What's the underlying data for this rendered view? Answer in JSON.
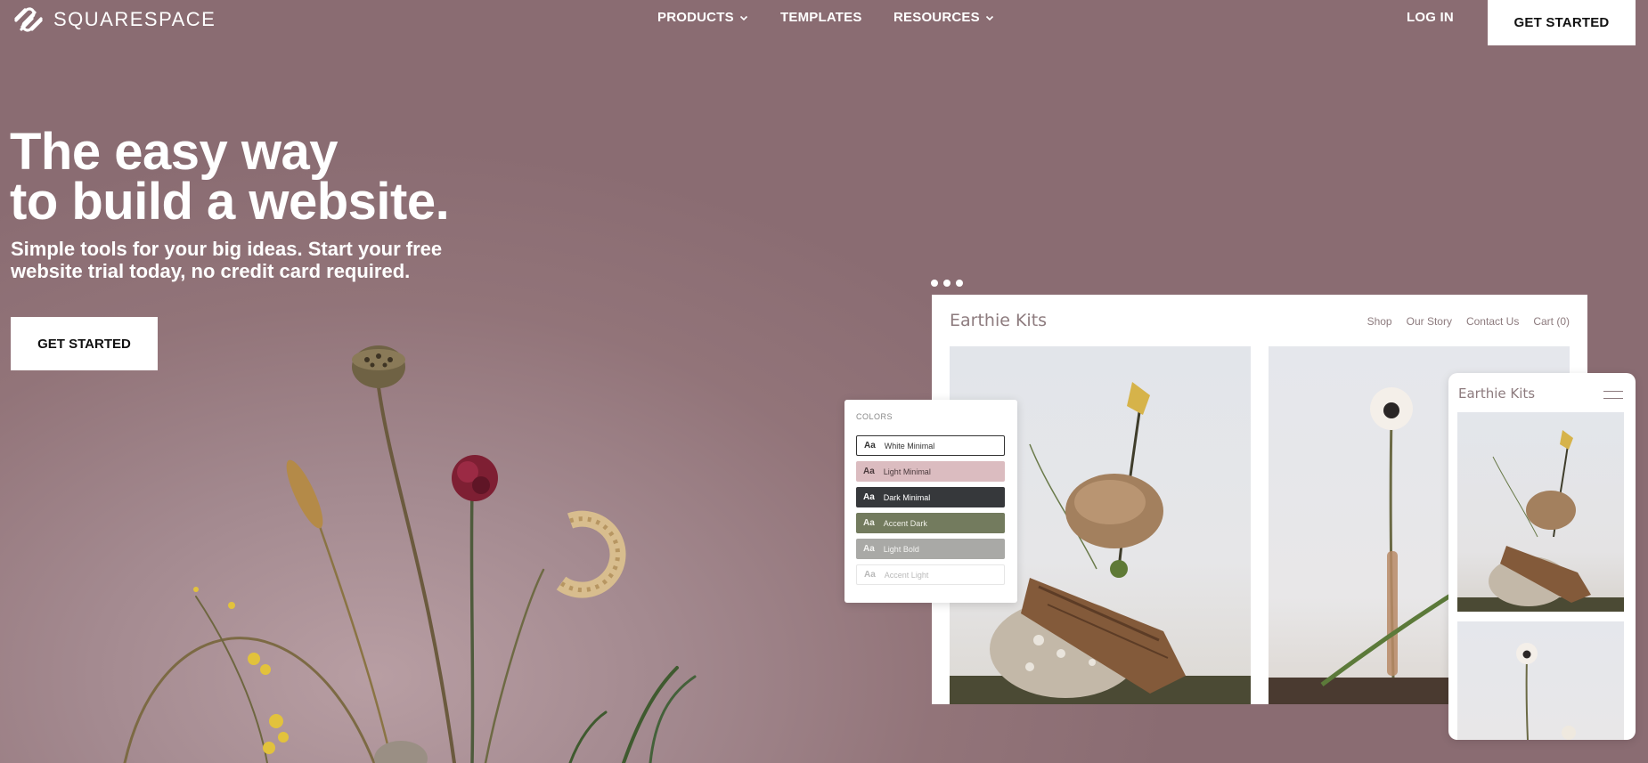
{
  "nav": {
    "logo_text": "SQUARESPACE",
    "logo_icon": "squarespace-logo-icon",
    "items": [
      {
        "label": "PRODUCTS",
        "has_dropdown": true
      },
      {
        "label": "TEMPLATES",
        "has_dropdown": false
      },
      {
        "label": "RESOURCES",
        "has_dropdown": true
      }
    ],
    "login_label": "LOG IN",
    "cta_label": "GET STARTED"
  },
  "hero": {
    "title_line1": "The easy way",
    "title_line2": "to build a website.",
    "subtitle_line1": "Simple tools for your big ideas. Start your free",
    "subtitle_line2": "website trial today, no credit card required.",
    "cta_label": "GET STARTED"
  },
  "desktop_mockup": {
    "brand": "Earthie Kits",
    "nav": [
      "Shop",
      "Our Story",
      "Contact Us",
      "Cart (0)"
    ]
  },
  "colors_panel": {
    "title": "COLORS",
    "swatch_glyph": "Aa",
    "swatches": [
      {
        "label": "White Minimal",
        "bg": "#ffffff",
        "fg": "#333333",
        "border": "#333333"
      },
      {
        "label": "Light Minimal",
        "bg": "#dbbcc0",
        "fg": "#4a3a3c",
        "border": "#dbbcc0"
      },
      {
        "label": "Dark Minimal",
        "bg": "#36383b",
        "fg": "#ffffff",
        "border": "#36383b"
      },
      {
        "label": "Accent Dark",
        "bg": "#737b5e",
        "fg": "#f0f0e8",
        "border": "#737b5e"
      },
      {
        "label": "Light Bold",
        "bg": "#a9a9a6",
        "fg": "#f4f4f2",
        "border": "#a9a9a6"
      },
      {
        "label": "Accent Light",
        "bg": "#ffffff",
        "fg": "#b9b9b9",
        "border": "#e6e6e6"
      }
    ]
  },
  "mobile_mockup": {
    "brand": "Earthie Kits"
  },
  "colors": {
    "background": "#937479",
    "white": "#ffffff",
    "brand_text": "#8d7b7e"
  }
}
